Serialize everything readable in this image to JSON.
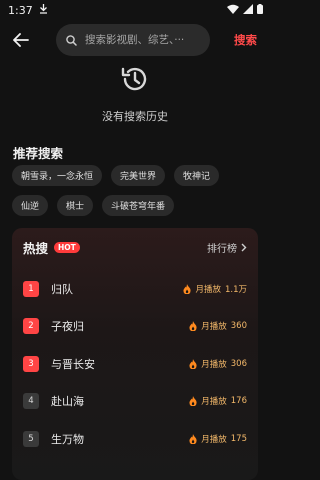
{
  "status": {
    "time": "1:37"
  },
  "search": {
    "placeholder": "搜索影视剧、综艺、···",
    "action_label": "搜索"
  },
  "history": {
    "empty_label": "没有搜索历史"
  },
  "recommend": {
    "title": "推荐搜索",
    "tags": [
      "朝雪录，一念永恒",
      "完美世界",
      "牧神记",
      "仙逆",
      "棋士",
      "斗破苍穹年番"
    ]
  },
  "hot": {
    "title": "热搜",
    "badge": "HOT",
    "rank_link": "排行榜",
    "items": [
      {
        "rank": "1",
        "name": "归队",
        "play_label": "月播放",
        "count": "1.1万"
      },
      {
        "rank": "2",
        "name": "子夜归",
        "play_label": "月播放",
        "count": "360"
      },
      {
        "rank": "3",
        "name": "与晋长安",
        "play_label": "月播放",
        "count": "306"
      },
      {
        "rank": "4",
        "name": "赴山海",
        "play_label": "月播放",
        "count": "176"
      },
      {
        "rank": "5",
        "name": "生万物",
        "play_label": "月播放",
        "count": "175"
      }
    ]
  },
  "colors": {
    "accent": "#ff4545",
    "play_text": "#f4b96a",
    "background": "#121212"
  }
}
